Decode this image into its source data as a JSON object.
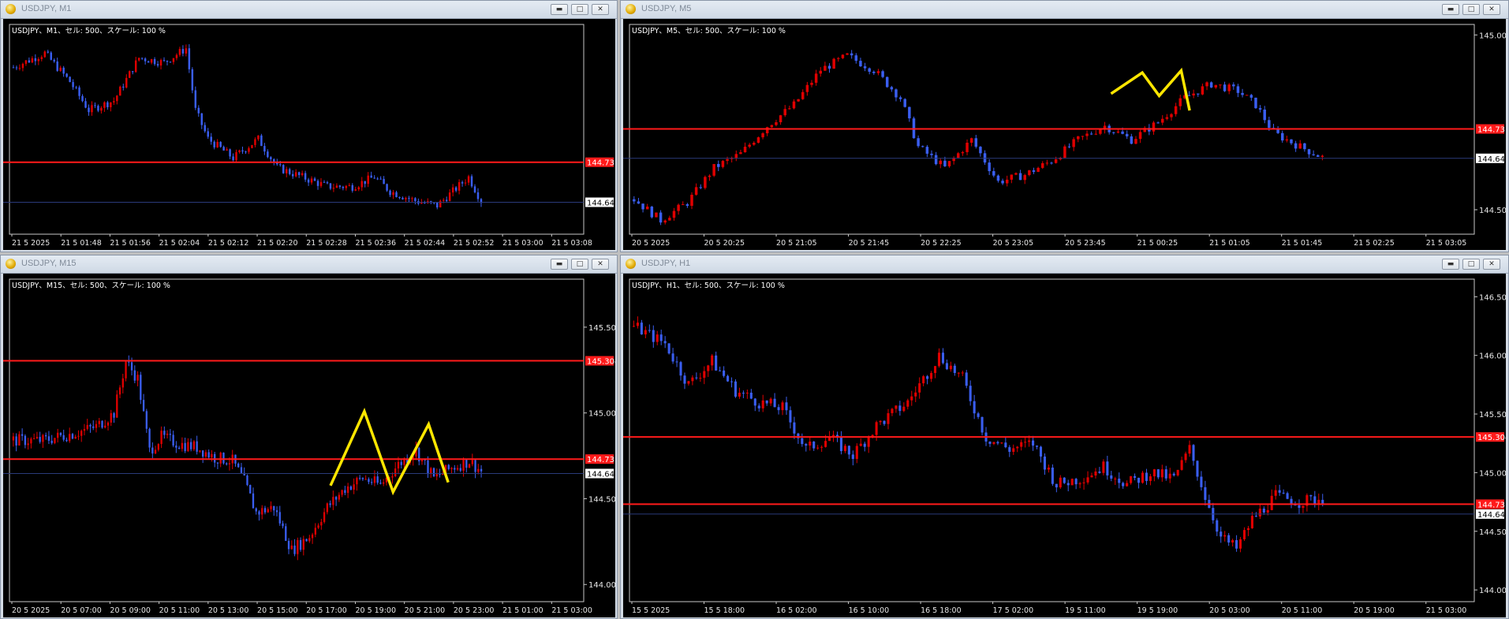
{
  "colors": {
    "bull": "#e00000",
    "bear": "#3a5ef0",
    "level": "#ff1a1a",
    "bid": "#2a3a7a",
    "pattern": "#ffe600",
    "bg": "#000000"
  },
  "windows": [
    {
      "id": "m1",
      "title": "USDJPY, M1",
      "info": "USDJPY、M1、セル: 500、スケール: 100 %",
      "xticks": [
        "21 5 2025",
        "21 5 01:48",
        "21 5 01:56",
        "21 5 02:04",
        "21 5 02:12",
        "21 5 02:20",
        "21 5 02:28",
        "21 5 02:36",
        "21 5 02:44",
        "21 5 02:52",
        "21 5 03:00",
        "21 5 03:08"
      ],
      "yticks": [],
      "ylim": [
        144.58,
        145.02
      ],
      "levels": [
        {
          "value": 144.731,
          "label": "144.731"
        }
      ],
      "bid": {
        "value": 144.647,
        "label": "144.647"
      },
      "anchors": [
        [
          0,
          144.93
        ],
        [
          10,
          144.96
        ],
        [
          18,
          144.9
        ],
        [
          24,
          144.84
        ],
        [
          32,
          144.86
        ],
        [
          40,
          144.95
        ],
        [
          48,
          144.94
        ],
        [
          55,
          144.97
        ],
        [
          58,
          144.84
        ],
        [
          62,
          144.78
        ],
        [
          70,
          144.74
        ],
        [
          78,
          144.78
        ],
        [
          84,
          144.72
        ],
        [
          92,
          144.7
        ],
        [
          100,
          144.68
        ],
        [
          108,
          144.68
        ],
        [
          115,
          144.7
        ],
        [
          120,
          144.67
        ],
        [
          128,
          144.65
        ],
        [
          135,
          144.64
        ],
        [
          140,
          144.67
        ],
        [
          145,
          144.7
        ],
        [
          149,
          144.65
        ]
      ],
      "pattern": []
    },
    {
      "id": "m5",
      "title": "USDJPY, M5",
      "info": "USDJPY、M5、セル: 500、スケール: 100 %",
      "xticks": [
        "20 5 2025",
        "20 5 20:25",
        "20 5 21:05",
        "20 5 21:45",
        "20 5 22:25",
        "20 5 23:05",
        "20 5 23:45",
        "21 5 00:25",
        "21 5 01:05",
        "21 5 01:45",
        "21 5 02:25",
        "21 5 03:05"
      ],
      "yticks": [
        {
          "v": 145.0,
          "label": "145.000"
        },
        {
          "v": 144.5,
          "label": "144.500"
        }
      ],
      "ylim": [
        144.43,
        145.03
      ],
      "levels": [
        {
          "value": 144.731,
          "label": "144.731"
        }
      ],
      "bid": {
        "value": 144.647,
        "label": "144.647"
      },
      "anchors": [
        [
          0,
          144.53
        ],
        [
          6,
          144.47
        ],
        [
          12,
          144.52
        ],
        [
          18,
          144.62
        ],
        [
          24,
          144.66
        ],
        [
          30,
          144.74
        ],
        [
          36,
          144.8
        ],
        [
          42,
          144.9
        ],
        [
          48,
          144.94
        ],
        [
          54,
          144.9
        ],
        [
          60,
          144.82
        ],
        [
          64,
          144.68
        ],
        [
          70,
          144.62
        ],
        [
          76,
          144.7
        ],
        [
          82,
          144.58
        ],
        [
          88,
          144.6
        ],
        [
          94,
          144.64
        ],
        [
          100,
          144.7
        ],
        [
          106,
          144.74
        ],
        [
          112,
          144.7
        ],
        [
          118,
          144.75
        ],
        [
          124,
          144.82
        ],
        [
          130,
          144.86
        ],
        [
          136,
          144.84
        ],
        [
          140,
          144.8
        ],
        [
          144,
          144.72
        ],
        [
          150,
          144.68
        ],
        [
          155,
          144.65
        ]
      ],
      "pattern": [
        [
          0.57,
          0.33
        ],
        [
          0.607,
          0.23
        ],
        [
          0.627,
          0.34
        ],
        [
          0.653,
          0.22
        ],
        [
          0.663,
          0.41
        ]
      ]
    },
    {
      "id": "m15",
      "title": "USDJPY, M15",
      "info": "USDJPY、M15、セル: 500、スケール: 100 %",
      "xticks": [
        "20 5 2025",
        "20 5 07:00",
        "20 5 09:00",
        "20 5 11:00",
        "20 5 13:00",
        "20 5 15:00",
        "20 5 17:00",
        "20 5 19:00",
        "20 5 21:00",
        "20 5 23:00",
        "21 5 01:00",
        "21 5 03:00"
      ],
      "yticks": [
        {
          "v": 145.5,
          "label": "145.500"
        },
        {
          "v": 145.0,
          "label": "145.000"
        },
        {
          "v": 144.5,
          "label": "144.500"
        },
        {
          "v": 144.0,
          "label": "144.000"
        }
      ],
      "ylim": [
        143.9,
        145.78
      ],
      "levels": [
        {
          "value": 145.304,
          "label": "145.304"
        },
        {
          "value": 144.731,
          "label": "144.731"
        }
      ],
      "bid": {
        "value": 144.647,
        "label": "144.647"
      },
      "anchors": [
        [
          0,
          144.84
        ],
        [
          10,
          144.84
        ],
        [
          20,
          144.88
        ],
        [
          28,
          144.92
        ],
        [
          34,
          145.0
        ],
        [
          38,
          145.3
        ],
        [
          42,
          145.2
        ],
        [
          46,
          144.78
        ],
        [
          50,
          144.86
        ],
        [
          56,
          144.82
        ],
        [
          62,
          144.8
        ],
        [
          68,
          144.74
        ],
        [
          74,
          144.72
        ],
        [
          78,
          144.6
        ],
        [
          82,
          144.42
        ],
        [
          88,
          144.45
        ],
        [
          94,
          144.2
        ],
        [
          100,
          144.28
        ],
        [
          106,
          144.45
        ],
        [
          112,
          144.56
        ],
        [
          118,
          144.62
        ],
        [
          124,
          144.58
        ],
        [
          130,
          144.7
        ],
        [
          136,
          144.78
        ],
        [
          142,
          144.62
        ],
        [
          148,
          144.68
        ],
        [
          154,
          144.72
        ],
        [
          158,
          144.66
        ]
      ],
      "pattern": [
        [
          0.559,
          0.64
        ],
        [
          0.618,
          0.41
        ],
        [
          0.668,
          0.66
        ],
        [
          0.73,
          0.45
        ],
        [
          0.764,
          0.63
        ]
      ]
    },
    {
      "id": "h1",
      "title": "USDJPY, H1",
      "info": "USDJPY、H1、セル: 500、スケール: 100 %",
      "xticks": [
        "15 5 2025",
        "15 5 18:00",
        "16 5 02:00",
        "16 5 10:00",
        "16 5 18:00",
        "17 5 02:00",
        "19 5 11:00",
        "19 5 19:00",
        "20 5 03:00",
        "20 5 11:00",
        "20 5 19:00",
        "21 5 03:00"
      ],
      "yticks": [
        {
          "v": 146.5,
          "label": "146.500"
        },
        {
          "v": 146.0,
          "label": "146.000"
        },
        {
          "v": 145.5,
          "label": "145.500"
        },
        {
          "v": 145.0,
          "label": "145.000"
        },
        {
          "v": 144.5,
          "label": "144.500"
        },
        {
          "v": 144.0,
          "label": "144.000"
        }
      ],
      "ylim": [
        143.9,
        146.65
      ],
      "levels": [
        {
          "value": 145.304,
          "label": "145.304"
        },
        {
          "value": 144.731,
          "label": "144.731"
        }
      ],
      "bid": {
        "value": 144.647,
        "label": "144.647"
      },
      "anchors": [
        [
          0,
          146.25
        ],
        [
          8,
          146.1
        ],
        [
          14,
          145.75
        ],
        [
          20,
          145.95
        ],
        [
          26,
          145.7
        ],
        [
          32,
          145.6
        ],
        [
          38,
          145.55
        ],
        [
          44,
          145.2
        ],
        [
          50,
          145.3
        ],
        [
          56,
          145.15
        ],
        [
          62,
          145.4
        ],
        [
          70,
          145.6
        ],
        [
          78,
          146.0
        ],
        [
          84,
          145.8
        ],
        [
          90,
          145.3
        ],
        [
          96,
          145.2
        ],
        [
          102,
          145.25
        ],
        [
          108,
          144.9
        ],
        [
          114,
          144.95
        ],
        [
          120,
          145.05
        ],
        [
          126,
          144.9
        ],
        [
          132,
          145.0
        ],
        [
          138,
          144.95
        ],
        [
          142,
          145.2
        ],
        [
          146,
          144.8
        ],
        [
          150,
          144.45
        ],
        [
          154,
          144.35
        ],
        [
          158,
          144.6
        ],
        [
          164,
          144.8
        ],
        [
          170,
          144.75
        ],
        [
          176,
          144.78
        ]
      ],
      "pattern": []
    }
  ]
}
